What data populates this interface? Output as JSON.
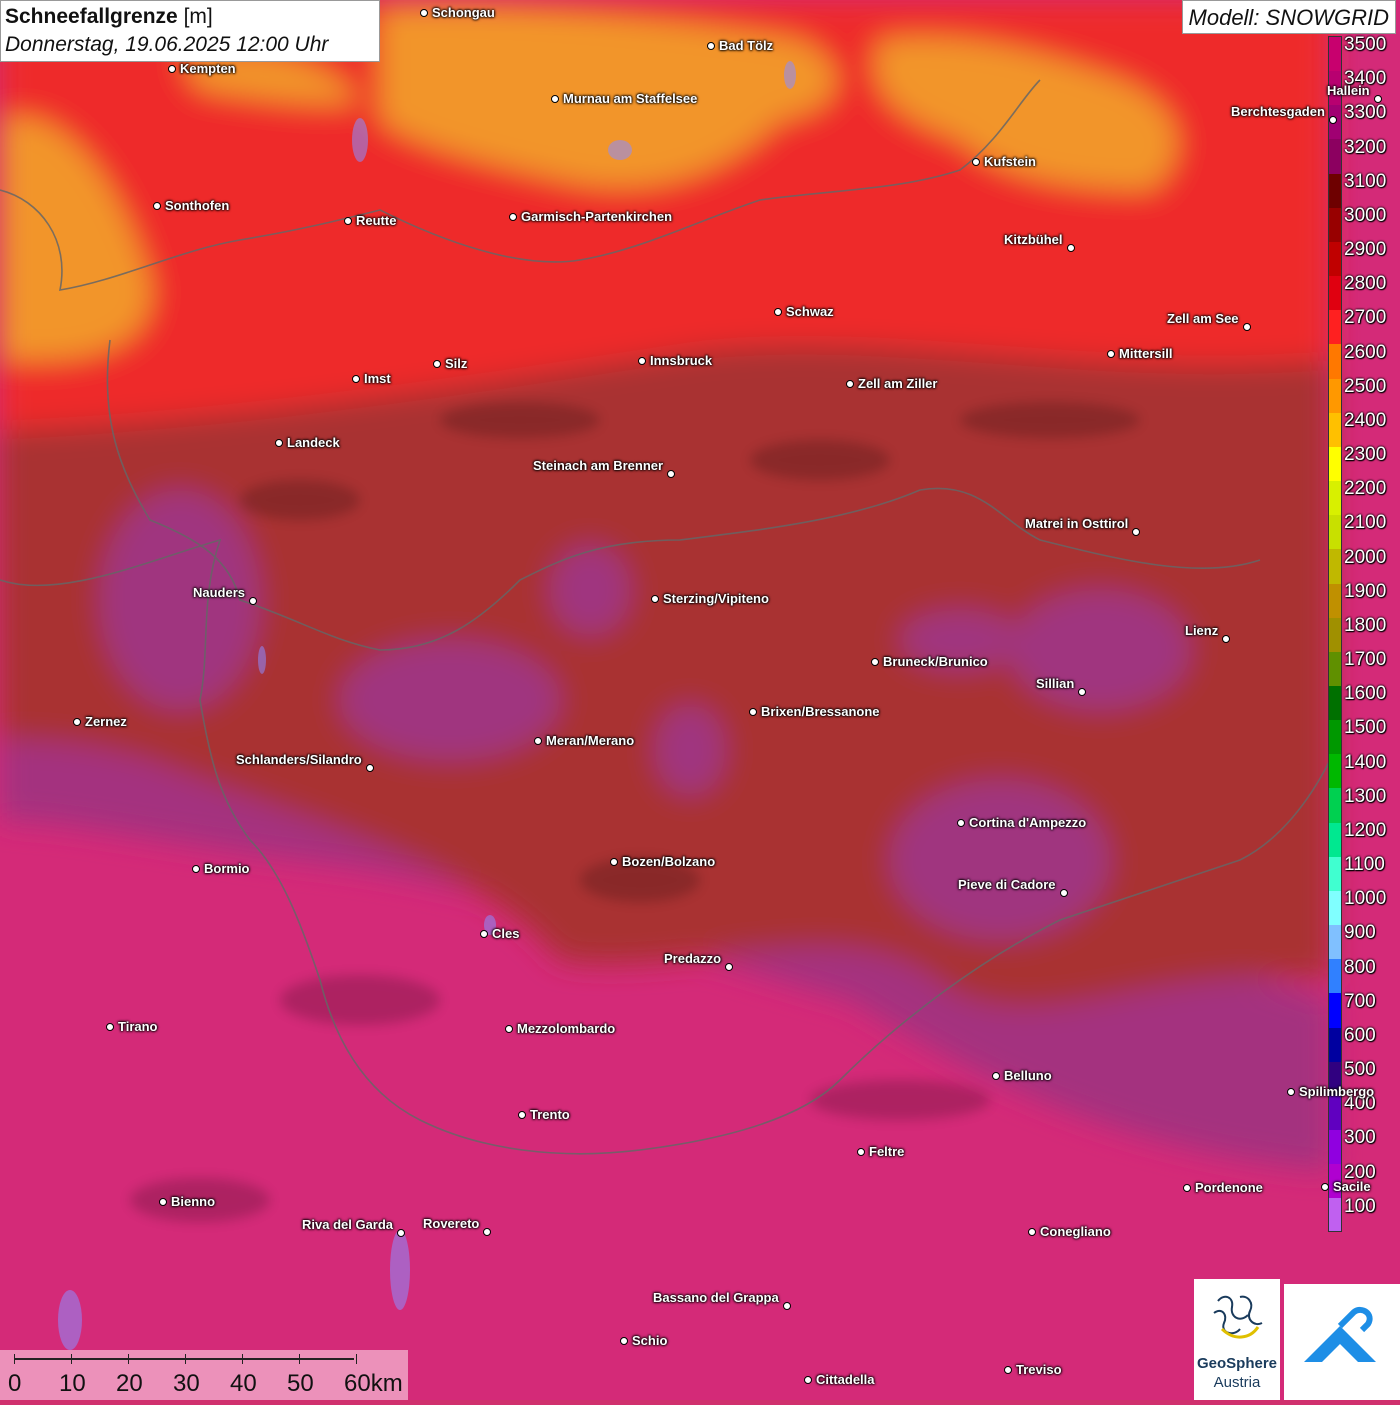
{
  "title": {
    "main": "Schneefallgrenze",
    "unit": "[m]",
    "datetime": "Donnerstag, 19.06.2025 12:00 Uhr"
  },
  "model": "Modell: SNOWGRID",
  "legend": {
    "labels": [
      "3500",
      "3400",
      "3300",
      "3200",
      "3100",
      "3000",
      "2900",
      "2800",
      "2700",
      "2600",
      "2500",
      "2400",
      "2300",
      "2200",
      "2100",
      "2000",
      "1900",
      "1800",
      "1700",
      "1600",
      "1500",
      "1400",
      "1300",
      "1200",
      "1100",
      "1000",
      "900",
      "800",
      "700",
      "600",
      "500",
      "400",
      "300",
      "200",
      "100"
    ],
    "colors": [
      "#c8006e",
      "#b80070",
      "#a00072",
      "#8c0060",
      "#6e0000",
      "#980000",
      "#c00000",
      "#e00010",
      "#ff2020",
      "#ff7800",
      "#ff9800",
      "#ffc000",
      "#ffff00",
      "#d8f000",
      "#c8e000",
      "#c0b800",
      "#c09000",
      "#a09000",
      "#609000",
      "#007000",
      "#009800",
      "#00b800",
      "#00d050",
      "#00e890",
      "#40ffd0",
      "#80ffff",
      "#80c0ff",
      "#3080ff",
      "#0000ff",
      "#0000a0",
      "#300080",
      "#6000c0",
      "#9000e0",
      "#b000d0",
      "#c060f0"
    ]
  },
  "cities": [
    {
      "name": "Schongau"
    },
    {
      "name": "Bad Tölz"
    },
    {
      "name": "Kempten"
    },
    {
      "name": "Murnau am Staffelsee"
    },
    {
      "name": "Berchtesgaden"
    },
    {
      "name": "Kufstein"
    },
    {
      "name": "Sonthofen"
    },
    {
      "name": "Reutte"
    },
    {
      "name": "Garmisch-Partenkirchen"
    },
    {
      "name": "Kitzbühel"
    },
    {
      "name": "Schwaz"
    },
    {
      "name": "Zell am See"
    },
    {
      "name": "Mittersill"
    },
    {
      "name": "Innsbruck"
    },
    {
      "name": "Imst"
    },
    {
      "name": "Silz"
    },
    {
      "name": "Zell am Ziller"
    },
    {
      "name": "Landeck"
    },
    {
      "name": "Steinach am Brenner"
    },
    {
      "name": "Matrei in Osttirol"
    },
    {
      "name": "Nauders"
    },
    {
      "name": "Sterzing/Vipiteno"
    },
    {
      "name": "Lienz"
    },
    {
      "name": "Bruneck/Brunico"
    },
    {
      "name": "Sillian"
    },
    {
      "name": "Zernez"
    },
    {
      "name": "Brixen/Bressanone"
    },
    {
      "name": "Meran/Merano"
    },
    {
      "name": "Schlanders/Silandro"
    },
    {
      "name": "Cortina d'Ampezzo"
    },
    {
      "name": "Bozen/Bolzano"
    },
    {
      "name": "Bormio"
    },
    {
      "name": "Pieve di Cadore"
    },
    {
      "name": "Cles"
    },
    {
      "name": "Predazzo"
    },
    {
      "name": "Tirano"
    },
    {
      "name": "Mezzolombardo"
    },
    {
      "name": "Belluno"
    },
    {
      "name": "Spilimbergo"
    },
    {
      "name": "Trento"
    },
    {
      "name": "Feltre"
    },
    {
      "name": "Pordenone"
    },
    {
      "name": "Bienno"
    },
    {
      "name": "Riva del Garda"
    },
    {
      "name": "Rovereto"
    },
    {
      "name": "Conegliano"
    },
    {
      "name": "Bassano del Grappa"
    },
    {
      "name": "Schio"
    },
    {
      "name": "Treviso"
    },
    {
      "name": "Cittadella"
    },
    {
      "name": "Hallein"
    },
    {
      "name": "Sacile"
    }
  ],
  "scalebar": {
    "labels": [
      "0",
      "10",
      "20",
      "30",
      "40",
      "50",
      "60km"
    ]
  },
  "logos": {
    "geosphere_line1": "GeoSphere",
    "geosphere_line2": "Austria"
  }
}
